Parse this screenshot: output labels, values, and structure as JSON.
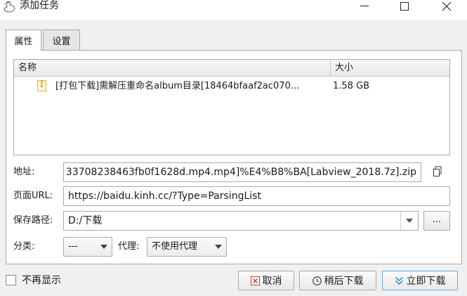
{
  "window": {
    "title": "添加任务"
  },
  "tabs": [
    {
      "label": "属性",
      "active": true
    },
    {
      "label": "设置",
      "active": false
    }
  ],
  "file_list": {
    "columns": [
      "名称",
      "大小"
    ],
    "rows": [
      {
        "name": "[打包下载]需解压重命名album目录[18464bfaaf2ac070...",
        "size": "1.58 GB",
        "icon": "archive-icon"
      }
    ]
  },
  "form": {
    "url_label": "地址:",
    "url_value": "33708238463fb0f1628d.mp4.mp4]%E4%B8%BA[Labview_2018.7z].zip",
    "page_url_label": "页面URL:",
    "page_url_value": "https://baidu.kinh.cc/?Type=ParsingList",
    "save_path_label": "保存路径:",
    "save_path_value": "D:/下载",
    "browse_label": "...",
    "category_label": "分类:",
    "category_value": "---",
    "proxy_label": "代理:",
    "proxy_value": "不使用代理"
  },
  "footer": {
    "dont_show_label": "不再显示",
    "cancel_label": "取消",
    "later_label": "稍后下载",
    "now_label": "立即下载"
  },
  "colors": {
    "accent": "#2a7bd3",
    "cancel_red": "#c0392b"
  }
}
